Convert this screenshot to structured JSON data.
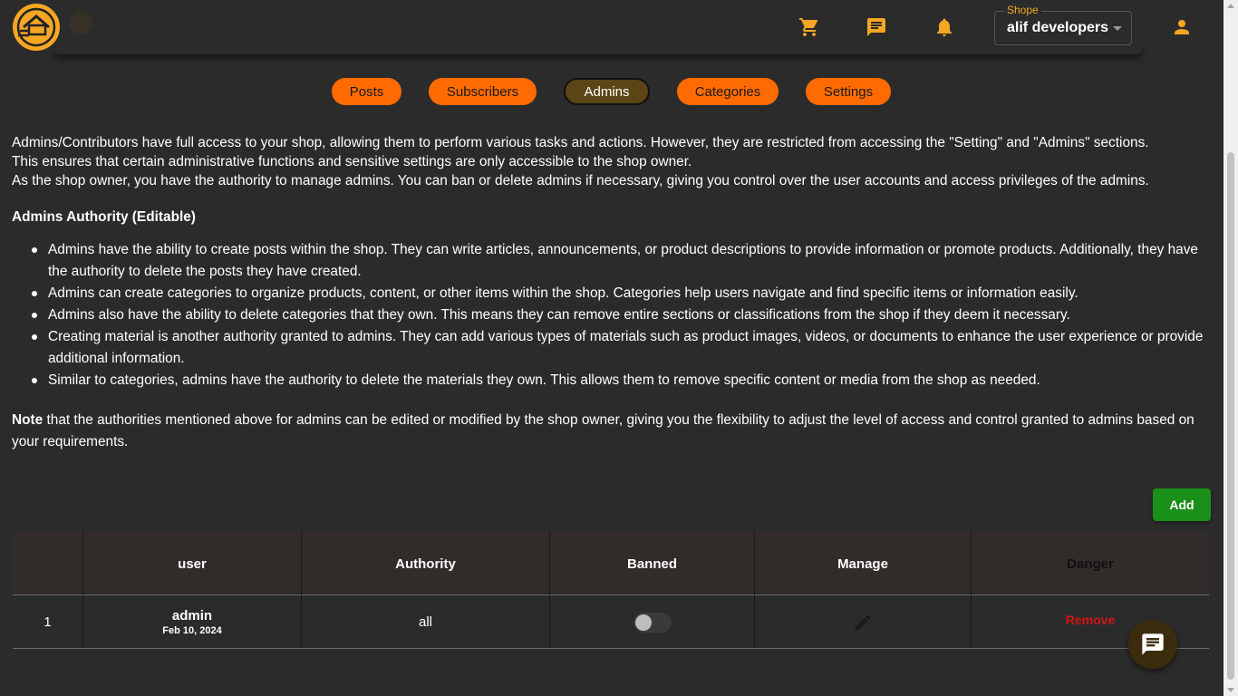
{
  "header": {
    "shop_label": "Shope",
    "shop_value": "alif developers",
    "icons": [
      "cart-icon",
      "message-icon",
      "bell-icon",
      "account-icon"
    ],
    "accent_color": "#f5a623"
  },
  "tabs": [
    {
      "label": "Posts",
      "active": false
    },
    {
      "label": "Subscribers",
      "active": false
    },
    {
      "label": "Admins",
      "active": true
    },
    {
      "label": "Categories",
      "active": false
    },
    {
      "label": "Settings",
      "active": false
    }
  ],
  "intro": {
    "line1": "Admins/Contributors have full access to your shop, allowing them to perform various tasks and actions. However, they are restricted from accessing the \"Setting\" and \"Admins\" sections.",
    "line2": "This ensures that certain administrative functions and sensitive settings are only accessible to the shop owner.",
    "line3": "As the shop owner, you have the authority to manage admins. You can ban or delete admins if necessary, giving you control over the user accounts and access privileges of the admins."
  },
  "authority": {
    "title": "Admins Authority (Editable)",
    "items": [
      "Admins have the ability to create posts within the shop. They can write articles, announcements, or product descriptions to provide information or promote products. Additionally, they have the authority to delete the posts they have created.",
      "Admins can create categories to organize products, content, or other items within the shop. Categories help users navigate and find specific items or information easily.",
      "Admins also have the ability to delete categories that they own. This means they can remove entire sections or classifications from the shop if they deem it necessary.",
      "Creating material is another authority granted to admins. They can add various types of materials such as product images, videos, or documents to enhance the user experience or provide additional information.",
      "Similar to categories, admins have the authority to delete the materials they own. This allows them to remove specific content or media from the shop as needed."
    ]
  },
  "note": {
    "bold": "Note",
    "text": " that the authorities mentioned above for admins can be edited or modified by the shop owner, giving you the flexibility to adjust the level of access and control granted to admins based on your requirements."
  },
  "add_button": "Add",
  "table": {
    "headers": [
      "",
      "user",
      "Authority",
      "Banned",
      "Manage",
      "Danger"
    ],
    "rows": [
      {
        "index": "1",
        "user": "admin",
        "date": "Feb 10, 2024",
        "authority": "all",
        "banned": false,
        "action": "Remove"
      }
    ]
  },
  "colors": {
    "tab": "#ff6b00",
    "tab_active": "#5c4514",
    "add": "#1a8f1a",
    "remove": "#d21414"
  }
}
